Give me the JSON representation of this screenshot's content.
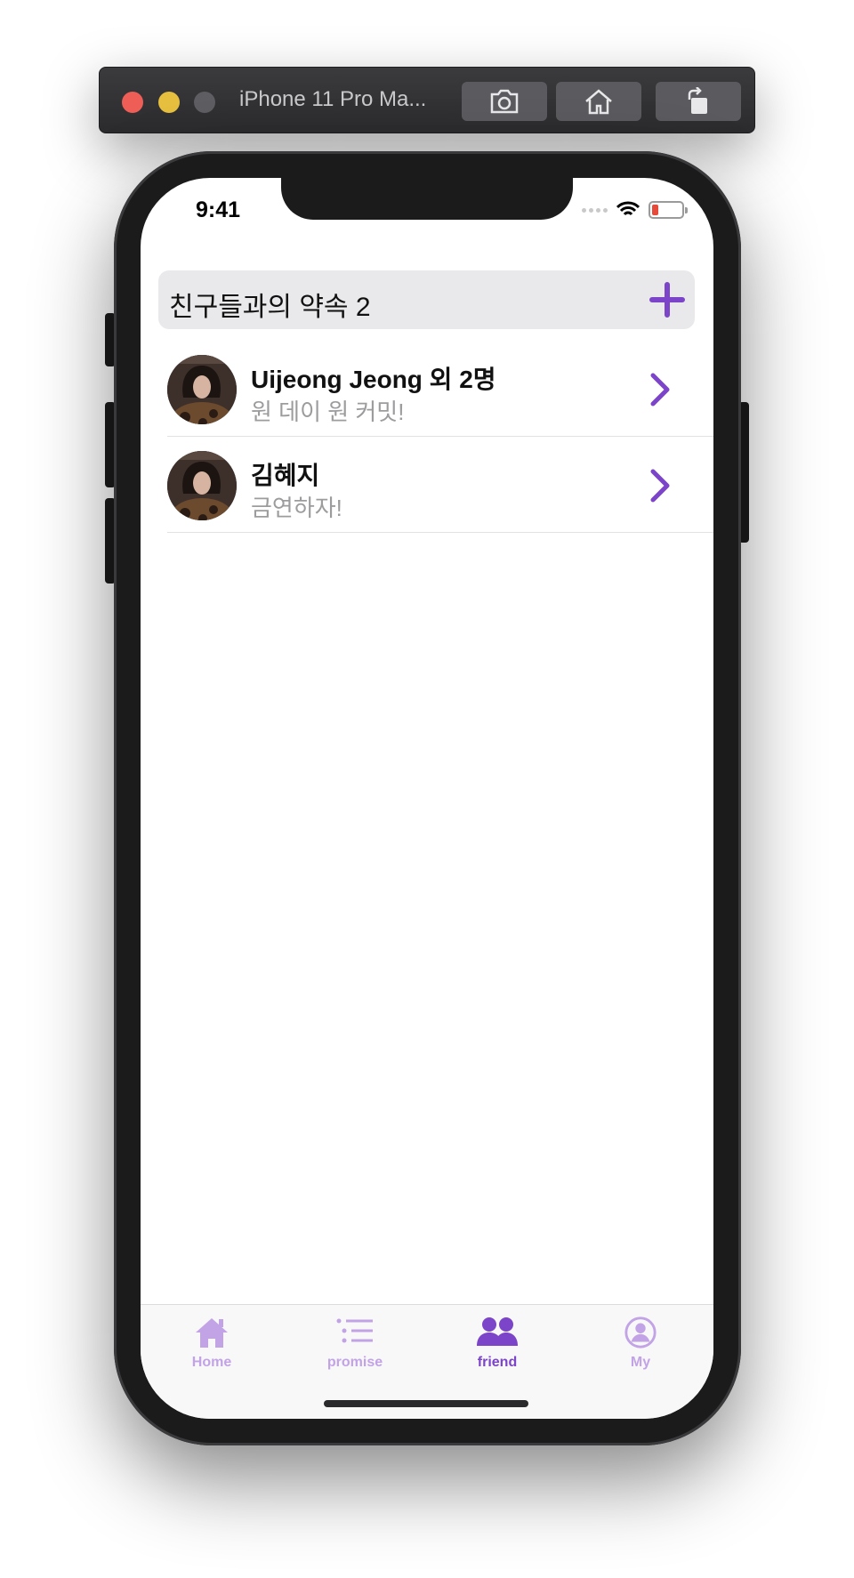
{
  "simulator": {
    "title": "iPhone 11 Pro Ma...",
    "buttons": [
      "screenshot-icon",
      "home-icon",
      "rotate-icon"
    ]
  },
  "status_bar": {
    "time": "9:41"
  },
  "header": {
    "title": "친구들과의 약속 2",
    "add_icon": "plus-icon"
  },
  "promises": [
    {
      "title": "Uijeong Jeong 외 2명",
      "subtitle": "원 데이 원 커밋!"
    },
    {
      "title": "김혜지",
      "subtitle": "금연하자!"
    }
  ],
  "tabs": [
    {
      "label": "Home",
      "icon": "house-icon",
      "active": false
    },
    {
      "label": "promise",
      "icon": "list-icon",
      "active": false
    },
    {
      "label": "friend",
      "icon": "people-icon",
      "active": true
    },
    {
      "label": "My",
      "icon": "person-circle-icon",
      "active": false
    }
  ],
  "colors": {
    "accent": "#7b44c9",
    "accent_light": "#c2a3e6",
    "subtitle": "#9c9c9e",
    "header_bg": "#e9e9eb"
  }
}
